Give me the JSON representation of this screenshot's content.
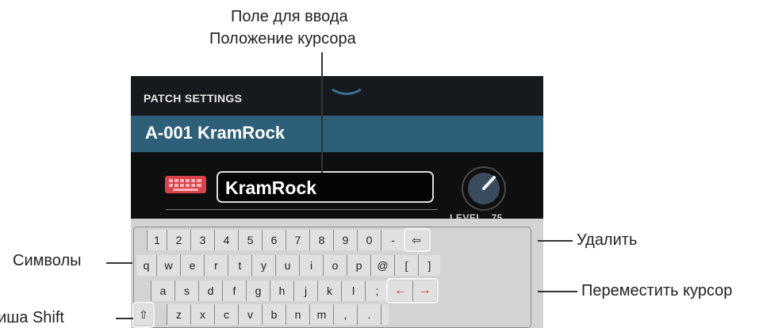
{
  "annotations": {
    "input_field_line1": "Поле для ввода",
    "input_field_line2": "Положение курсора",
    "delete": "Удалить",
    "symbols": "Символы",
    "move_cursor": "Переместить курсор",
    "shift_key": "Клавиша Shift"
  },
  "header": {
    "title": "PATCH SETTINGS"
  },
  "patch": {
    "name": "A-001 KramRock"
  },
  "name_field": {
    "value": "KramRock"
  },
  "level": {
    "label": "LEVEL",
    "value": "75"
  },
  "keyboard": {
    "row1": [
      "1",
      "2",
      "3",
      "4",
      "5",
      "6",
      "7",
      "8",
      "9",
      "0",
      "-"
    ],
    "backspace": "⇦",
    "row2": [
      "q",
      "w",
      "e",
      "r",
      "t",
      "y",
      "u",
      "i",
      "o",
      "p",
      "@",
      "[",
      "]"
    ],
    "row3": [
      "a",
      "s",
      "d",
      "f",
      "g",
      "h",
      "j",
      "k",
      "l",
      ";"
    ],
    "cursor_left": "←",
    "cursor_right": "→",
    "shift": "⇧",
    "row4": [
      "z",
      "x",
      "c",
      "v",
      "b",
      "n",
      "m",
      ",",
      "."
    ],
    "accent_color": "#e01b1b"
  }
}
